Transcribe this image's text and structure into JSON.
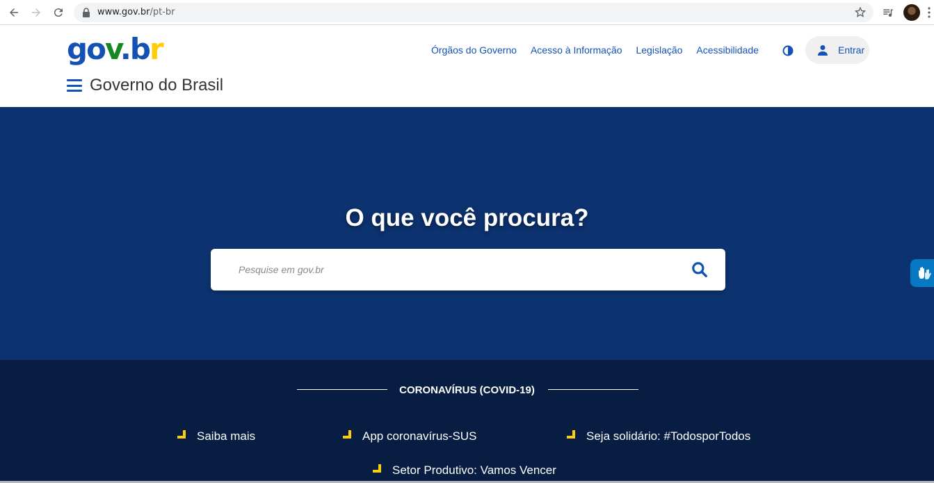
{
  "browser": {
    "url_host": "www.gov.br",
    "url_path": "/pt-br",
    "icons": [
      "back-icon",
      "forward-icon",
      "reload-icon",
      "lock-icon",
      "star-icon",
      "media-icon",
      "avatar",
      "kebab-icon"
    ]
  },
  "header": {
    "logo": {
      "g": "g",
      "o": "o",
      "v": "v",
      "dot": ".",
      "b": "b",
      "r": "r"
    },
    "nav": [
      {
        "label": "Órgãos do Governo"
      },
      {
        "label": "Acesso à Informação"
      },
      {
        "label": "Legislação"
      },
      {
        "label": "Acessibilidade"
      }
    ],
    "login_label": "Entrar",
    "site_title": "Governo do Brasil"
  },
  "hero": {
    "heading": "O que você procura?",
    "search_placeholder": "Pesquise em gov.br"
  },
  "covid": {
    "title": "CORONAVÍRUS (COVID-19)",
    "links": [
      {
        "label": "Saiba mais"
      },
      {
        "label": "App coronavírus-SUS"
      },
      {
        "label": "Seja solidário: #TodosporTodos"
      },
      {
        "label": "Setor Produtivo: Vamos Vencer"
      }
    ]
  },
  "colors": {
    "primary": "#1351b4",
    "hero_bg": "#0c326f",
    "covid_bg": "#071d41",
    "accent_yellow": "#ffcd07",
    "accent_green": "#168821"
  }
}
